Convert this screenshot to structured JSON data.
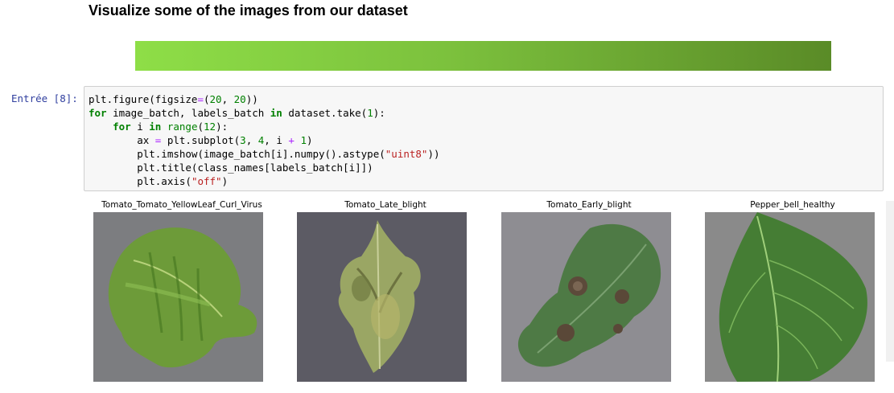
{
  "heading": "Visualize some of the images from our dataset",
  "banner": {
    "gradient": [
      "#8ede47",
      "#5a8b27"
    ]
  },
  "cell": {
    "prompt": "Entrée [8]:",
    "lines": [
      [
        [
          "",
          "plt.figure(figsize"
        ],
        [
          "op",
          "="
        ],
        [
          "",
          "("
        ],
        [
          "num",
          "20"
        ],
        [
          "",
          ", "
        ],
        [
          "num",
          "20"
        ],
        [
          "",
          "))"
        ]
      ],
      [
        [
          "kw",
          "for"
        ],
        [
          "",
          " image_batch, labels_batch "
        ],
        [
          "kw",
          "in"
        ],
        [
          "",
          " dataset.take("
        ],
        [
          "num",
          "1"
        ],
        [
          "",
          "):"
        ]
      ],
      [
        [
          "",
          "    "
        ],
        [
          "kw",
          "for"
        ],
        [
          "",
          " i "
        ],
        [
          "kw",
          "in"
        ],
        [
          "",
          " "
        ],
        [
          "num",
          "range"
        ],
        [
          "",
          "("
        ],
        [
          "num",
          "12"
        ],
        [
          "",
          "):"
        ]
      ],
      [
        [
          "",
          "        ax "
        ],
        [
          "op",
          "="
        ],
        [
          "",
          " plt.subplot("
        ],
        [
          "num",
          "3"
        ],
        [
          "",
          ", "
        ],
        [
          "num",
          "4"
        ],
        [
          "",
          ", i "
        ],
        [
          "op",
          "+"
        ],
        [
          "",
          " "
        ],
        [
          "num",
          "1"
        ],
        [
          "",
          ")"
        ]
      ],
      [
        [
          "",
          "        plt.imshow(image_batch[i].numpy().astype("
        ],
        [
          "str",
          "\"uint8\""
        ],
        [
          "",
          "))"
        ]
      ],
      [
        [
          "",
          "        plt.title(class_names[labels_batch[i]])"
        ]
      ],
      [
        [
          "",
          "        plt.axis("
        ],
        [
          "str",
          "\"off\""
        ],
        [
          "",
          ")"
        ]
      ]
    ]
  },
  "output": {
    "panels": [
      {
        "title": "Tomato_Tomato_YellowLeaf_Curl_Virus",
        "image": "leaf-curl-virus-photo",
        "bg": "#7c7d80",
        "leaf": "#6e9a3a"
      },
      {
        "title": "Tomato_Late_blight",
        "image": "late-blight-leaf-photo",
        "bg": "#5e5d66",
        "leaf": "#9aa566"
      },
      {
        "title": "Tomato_Early_blight",
        "image": "early-blight-leaf-photo",
        "bg": "#8d8c91",
        "leaf": "#4f7a46"
      },
      {
        "title": "Pepper_bell_healthy",
        "image": "healthy-pepper-leaf-photo",
        "bg": "#8a8a8a",
        "leaf": "#457d34"
      }
    ]
  }
}
